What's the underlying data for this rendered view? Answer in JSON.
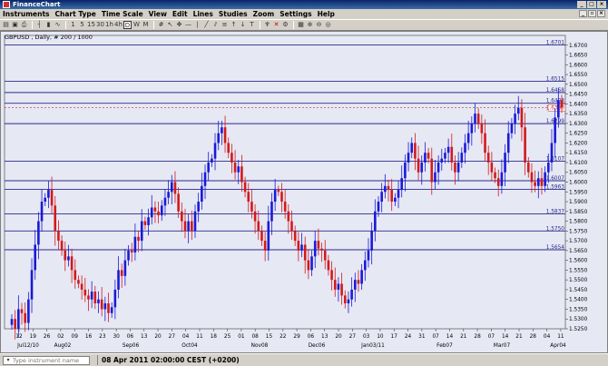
{
  "window": {
    "title": "FinanceChart"
  },
  "menu": [
    "Instruments",
    "Chart Type",
    "Time Scale",
    "View",
    "Edit",
    "Lines",
    "Studies",
    "Zoom",
    "Settings",
    "Help"
  ],
  "toolbar_icons": [
    "open-icon",
    "save-icon",
    "print-icon",
    "bar-chart-icon",
    "candle-chart-icon",
    "line-chart-icon",
    "1-icon",
    "5-icon",
    "15-icon",
    "30-icon",
    "1h-icon",
    "4h-icon",
    "d-icon",
    "w-icon",
    "m-icon",
    "crosshair-icon",
    "pointer-icon",
    "zoom-in-icon",
    "zoom-out-icon"
  ],
  "chart_header": "GBPUSD , Daily, # 200 / 1000",
  "status": {
    "instrument_placeholder": "Type instrument name",
    "time": "08 Apr 2011 02:00:00  CEST (+0200)"
  },
  "colors": {
    "up": "#1a1ad6",
    "down": "#d21a1a",
    "background": "#e6e8f4",
    "line": "#2a2a8a",
    "dashed": "#c03030"
  },
  "chart_data": {
    "type": "candlestick",
    "symbol": "GBPUSD",
    "timeframe": "Daily",
    "ylim": [
      1.525,
      1.675
    ],
    "y_ticks": [
      "1.6700",
      "1.6650",
      "1.6600",
      "1.6550",
      "1.6500",
      "1.6450",
      "1.6400",
      "1.6350",
      "1.6300",
      "1.6250",
      "1.6200",
      "1.6150",
      "1.6100",
      "1.6050",
      "1.6000",
      "1.5950",
      "1.5900",
      "1.5850",
      "1.5800",
      "1.5750",
      "1.5700",
      "1.5650",
      "1.5600",
      "1.5550",
      "1.5500",
      "1.5450",
      "1.5400",
      "1.5350",
      "1.5300",
      "1.5250"
    ],
    "x_ticks": [
      "12",
      "19",
      "26",
      "02",
      "09",
      "16",
      "23",
      "30",
      "06",
      "13",
      "20",
      "27",
      "04",
      "11",
      "18",
      "25",
      "01",
      "08",
      "15",
      "22",
      "29",
      "06",
      "13",
      "20",
      "27",
      "03",
      "10",
      "17",
      "24",
      "31",
      "07",
      "14",
      "21",
      "28",
      "07",
      "14",
      "21",
      "28",
      "04",
      "11"
    ],
    "month_labels": [
      "Jul12/10",
      "Aug02",
      "Sep06",
      "Oct04",
      "Nov08",
      "Dec06",
      "Jan03/11",
      "Feb07",
      "Mar07",
      "Apr04"
    ],
    "levels": [
      {
        "label": "1.6701",
        "value": 1.6701
      },
      {
        "label": "1.6515",
        "value": 1.6515
      },
      {
        "label": "1.6458",
        "value": 1.6458
      },
      {
        "label": "1.6403",
        "value": 1.6403
      },
      {
        "label": "1.6299",
        "value": 1.6299
      },
      {
        "label": "1.6107",
        "value": 1.6107
      },
      {
        "label": "1.6007",
        "value": 1.6007
      },
      {
        "label": "1.5963",
        "value": 1.5963
      },
      {
        "label": "1.5837",
        "value": 1.5837
      },
      {
        "label": "1.5750",
        "value": 1.575
      },
      {
        "label": "1.5654",
        "value": 1.5654
      }
    ],
    "current_price": {
      "label": "1.6380",
      "value": 1.638
    },
    "closes": [
      1.53,
      1.525,
      1.535,
      1.533,
      1.528,
      1.54,
      1.555,
      1.568,
      1.58,
      1.59,
      1.592,
      1.596,
      1.588,
      1.575,
      1.57,
      1.565,
      1.56,
      1.562,
      1.555,
      1.55,
      1.548,
      1.545,
      1.542,
      1.54,
      1.544,
      1.538,
      1.54,
      1.535,
      1.538,
      1.533,
      1.536,
      1.545,
      1.555,
      1.552,
      1.56,
      1.565,
      1.564,
      1.572,
      1.57,
      1.58,
      1.578,
      1.582,
      1.587,
      1.585,
      1.583,
      1.588,
      1.592,
      1.595,
      1.6,
      1.594,
      1.585,
      1.58,
      1.575,
      1.58,
      1.575,
      1.585,
      1.59,
      1.598,
      1.605,
      1.61,
      1.612,
      1.62,
      1.625,
      1.628,
      1.62,
      1.615,
      1.61,
      1.605,
      1.608,
      1.6,
      1.595,
      1.59,
      1.585,
      1.58,
      1.575,
      1.57,
      1.565,
      1.58,
      1.59,
      1.596,
      1.595,
      1.59,
      1.585,
      1.58,
      1.575,
      1.57,
      1.565,
      1.568,
      1.56,
      1.555,
      1.562,
      1.57,
      1.566,
      1.565,
      1.56,
      1.555,
      1.55,
      1.545,
      1.548,
      1.542,
      1.538,
      1.54,
      1.545,
      1.55,
      1.548,
      1.555,
      1.56,
      1.565,
      1.575,
      1.585,
      1.59,
      1.595,
      1.598,
      1.596,
      1.59,
      1.592,
      1.596,
      1.602,
      1.61,
      1.615,
      1.62,
      1.612,
      1.605,
      1.61,
      1.615,
      1.612,
      1.6,
      1.605,
      1.61,
      1.612,
      1.615,
      1.618,
      1.61,
      1.605,
      1.61,
      1.615,
      1.62,
      1.625,
      1.63,
      1.635,
      1.63,
      1.625,
      1.615,
      1.61,
      1.605,
      1.602,
      1.598,
      1.605,
      1.615,
      1.625,
      1.63,
      1.635,
      1.638,
      1.628,
      1.61,
      1.605,
      1.6,
      1.598,
      1.602,
      1.598,
      1.605,
      1.61,
      1.62,
      1.633,
      1.642,
      1.638
    ]
  }
}
